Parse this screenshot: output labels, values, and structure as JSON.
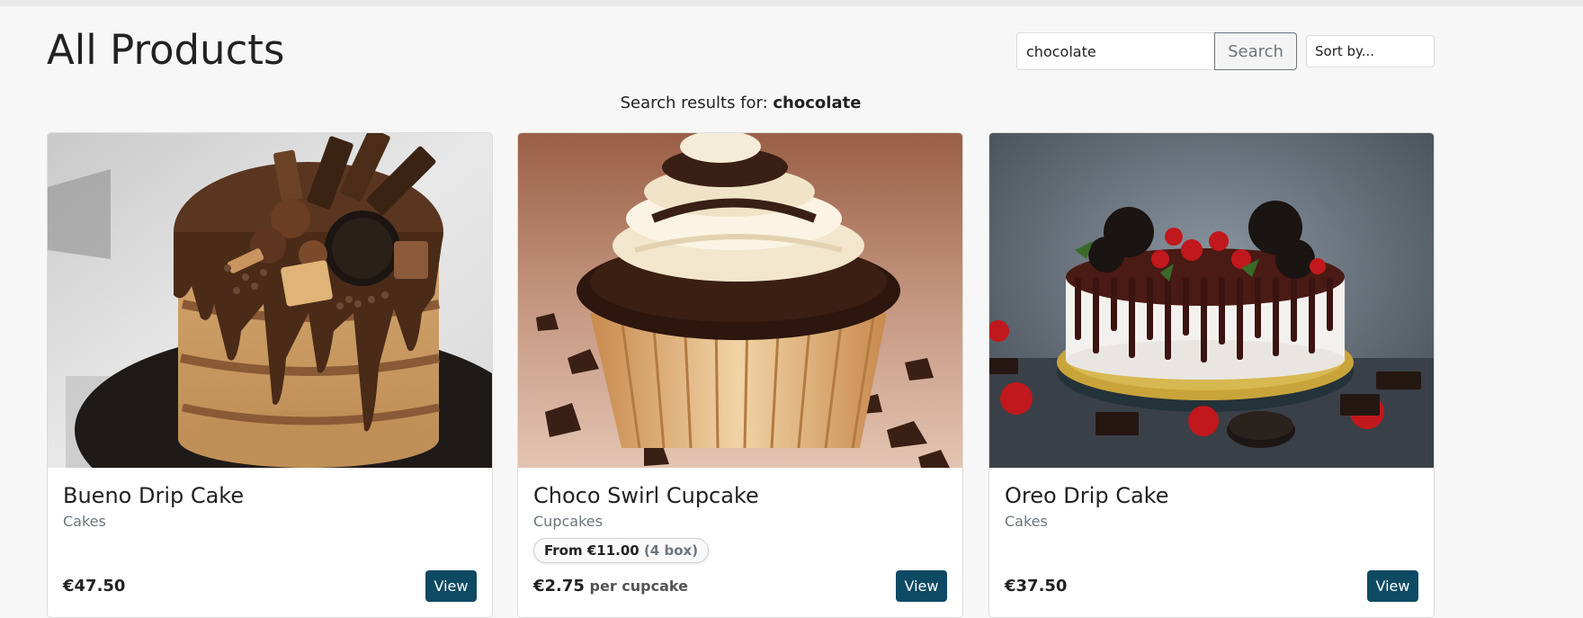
{
  "page": {
    "title": "All Products"
  },
  "search": {
    "value": "chocolate",
    "button_label": "Search",
    "sort_label": "Sort by..."
  },
  "results": {
    "prefix": "Search results for: ",
    "query": "chocolate"
  },
  "products": [
    {
      "name": "Bueno Drip Cake",
      "category": "Cakes",
      "price": "€47.50",
      "price_unit": "",
      "badge_main": "",
      "badge_extra": "",
      "view_label": "View",
      "image": "chocolate-drip-cake-with-bueno-bars-photo"
    },
    {
      "name": "Choco Swirl Cupcake",
      "category": "Cupcakes",
      "price": "€2.75",
      "price_unit": " per cupcake",
      "badge_main": "From €11.00",
      "badge_extra": " (4 box)",
      "view_label": "View",
      "image": "chocolate-cream-swirl-cupcake-photo"
    },
    {
      "name": "Oreo Drip Cake",
      "category": "Cakes",
      "price": "€37.50",
      "price_unit": "",
      "badge_main": "",
      "badge_extra": "",
      "view_label": "View",
      "image": "oreo-chocolate-drip-cake-photo"
    }
  ],
  "colors": {
    "primary_button": "#0e4a63",
    "page_background": "#f7f7f7",
    "muted_text": "#6c757d"
  }
}
